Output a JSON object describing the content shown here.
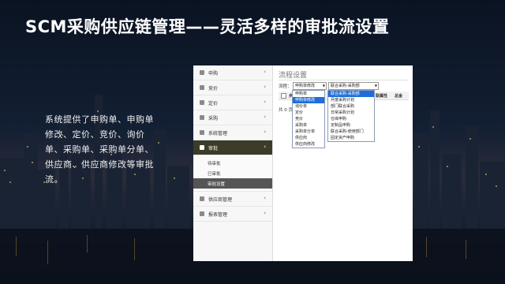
{
  "slide": {
    "title": "SCM采购供应链管理——灵活多样的审批流设置",
    "description": "系统提供了申购单、申购单修改、定价、竞价、询价单、采购单、采购单分单、供应商、供应商修改等审批流。"
  },
  "sidebar": {
    "items": [
      {
        "label": "申购",
        "icon": "cart-icon"
      },
      {
        "label": "竞价",
        "icon": "tag-icon"
      },
      {
        "label": "定价",
        "icon": "price-icon"
      },
      {
        "label": "采购",
        "icon": "basket-icon"
      },
      {
        "label": "系统管理",
        "icon": "gear-icon"
      },
      {
        "label": "审批",
        "icon": "check-icon"
      },
      {
        "label": "供应商管理",
        "icon": "user-icon"
      },
      {
        "label": "报表管理",
        "icon": "report-icon"
      }
    ],
    "approval_sub": [
      "待审批",
      "已审批",
      "审批设置"
    ]
  },
  "main": {
    "page_title": "流程设置",
    "flow_label": "流程：",
    "select1_value": "申购单修改",
    "select2_value": "联合采购-采购部",
    "col_step": "步",
    "col_attr": "联属性",
    "col_total": "总金",
    "count_text": "共 0 页",
    "dropdown1": [
      "申购单",
      "申购单修改",
      "询价单",
      "定价",
      "竞价",
      "采购单",
      "采购单分单",
      "供应商",
      "供应商修改"
    ],
    "dropdown1_selected": 1,
    "dropdown2": [
      "联合采购-采购部",
      "月度采购计划",
      "部门联合采购",
      "日常采购计划",
      "仓库申购",
      "定制品申购",
      "联合采购-使用部门",
      "固定资产申购"
    ],
    "dropdown2_selected": 0
  },
  "colors": {
    "active_nav": "#3c3c28",
    "highlight": "#1e6fd9"
  }
}
